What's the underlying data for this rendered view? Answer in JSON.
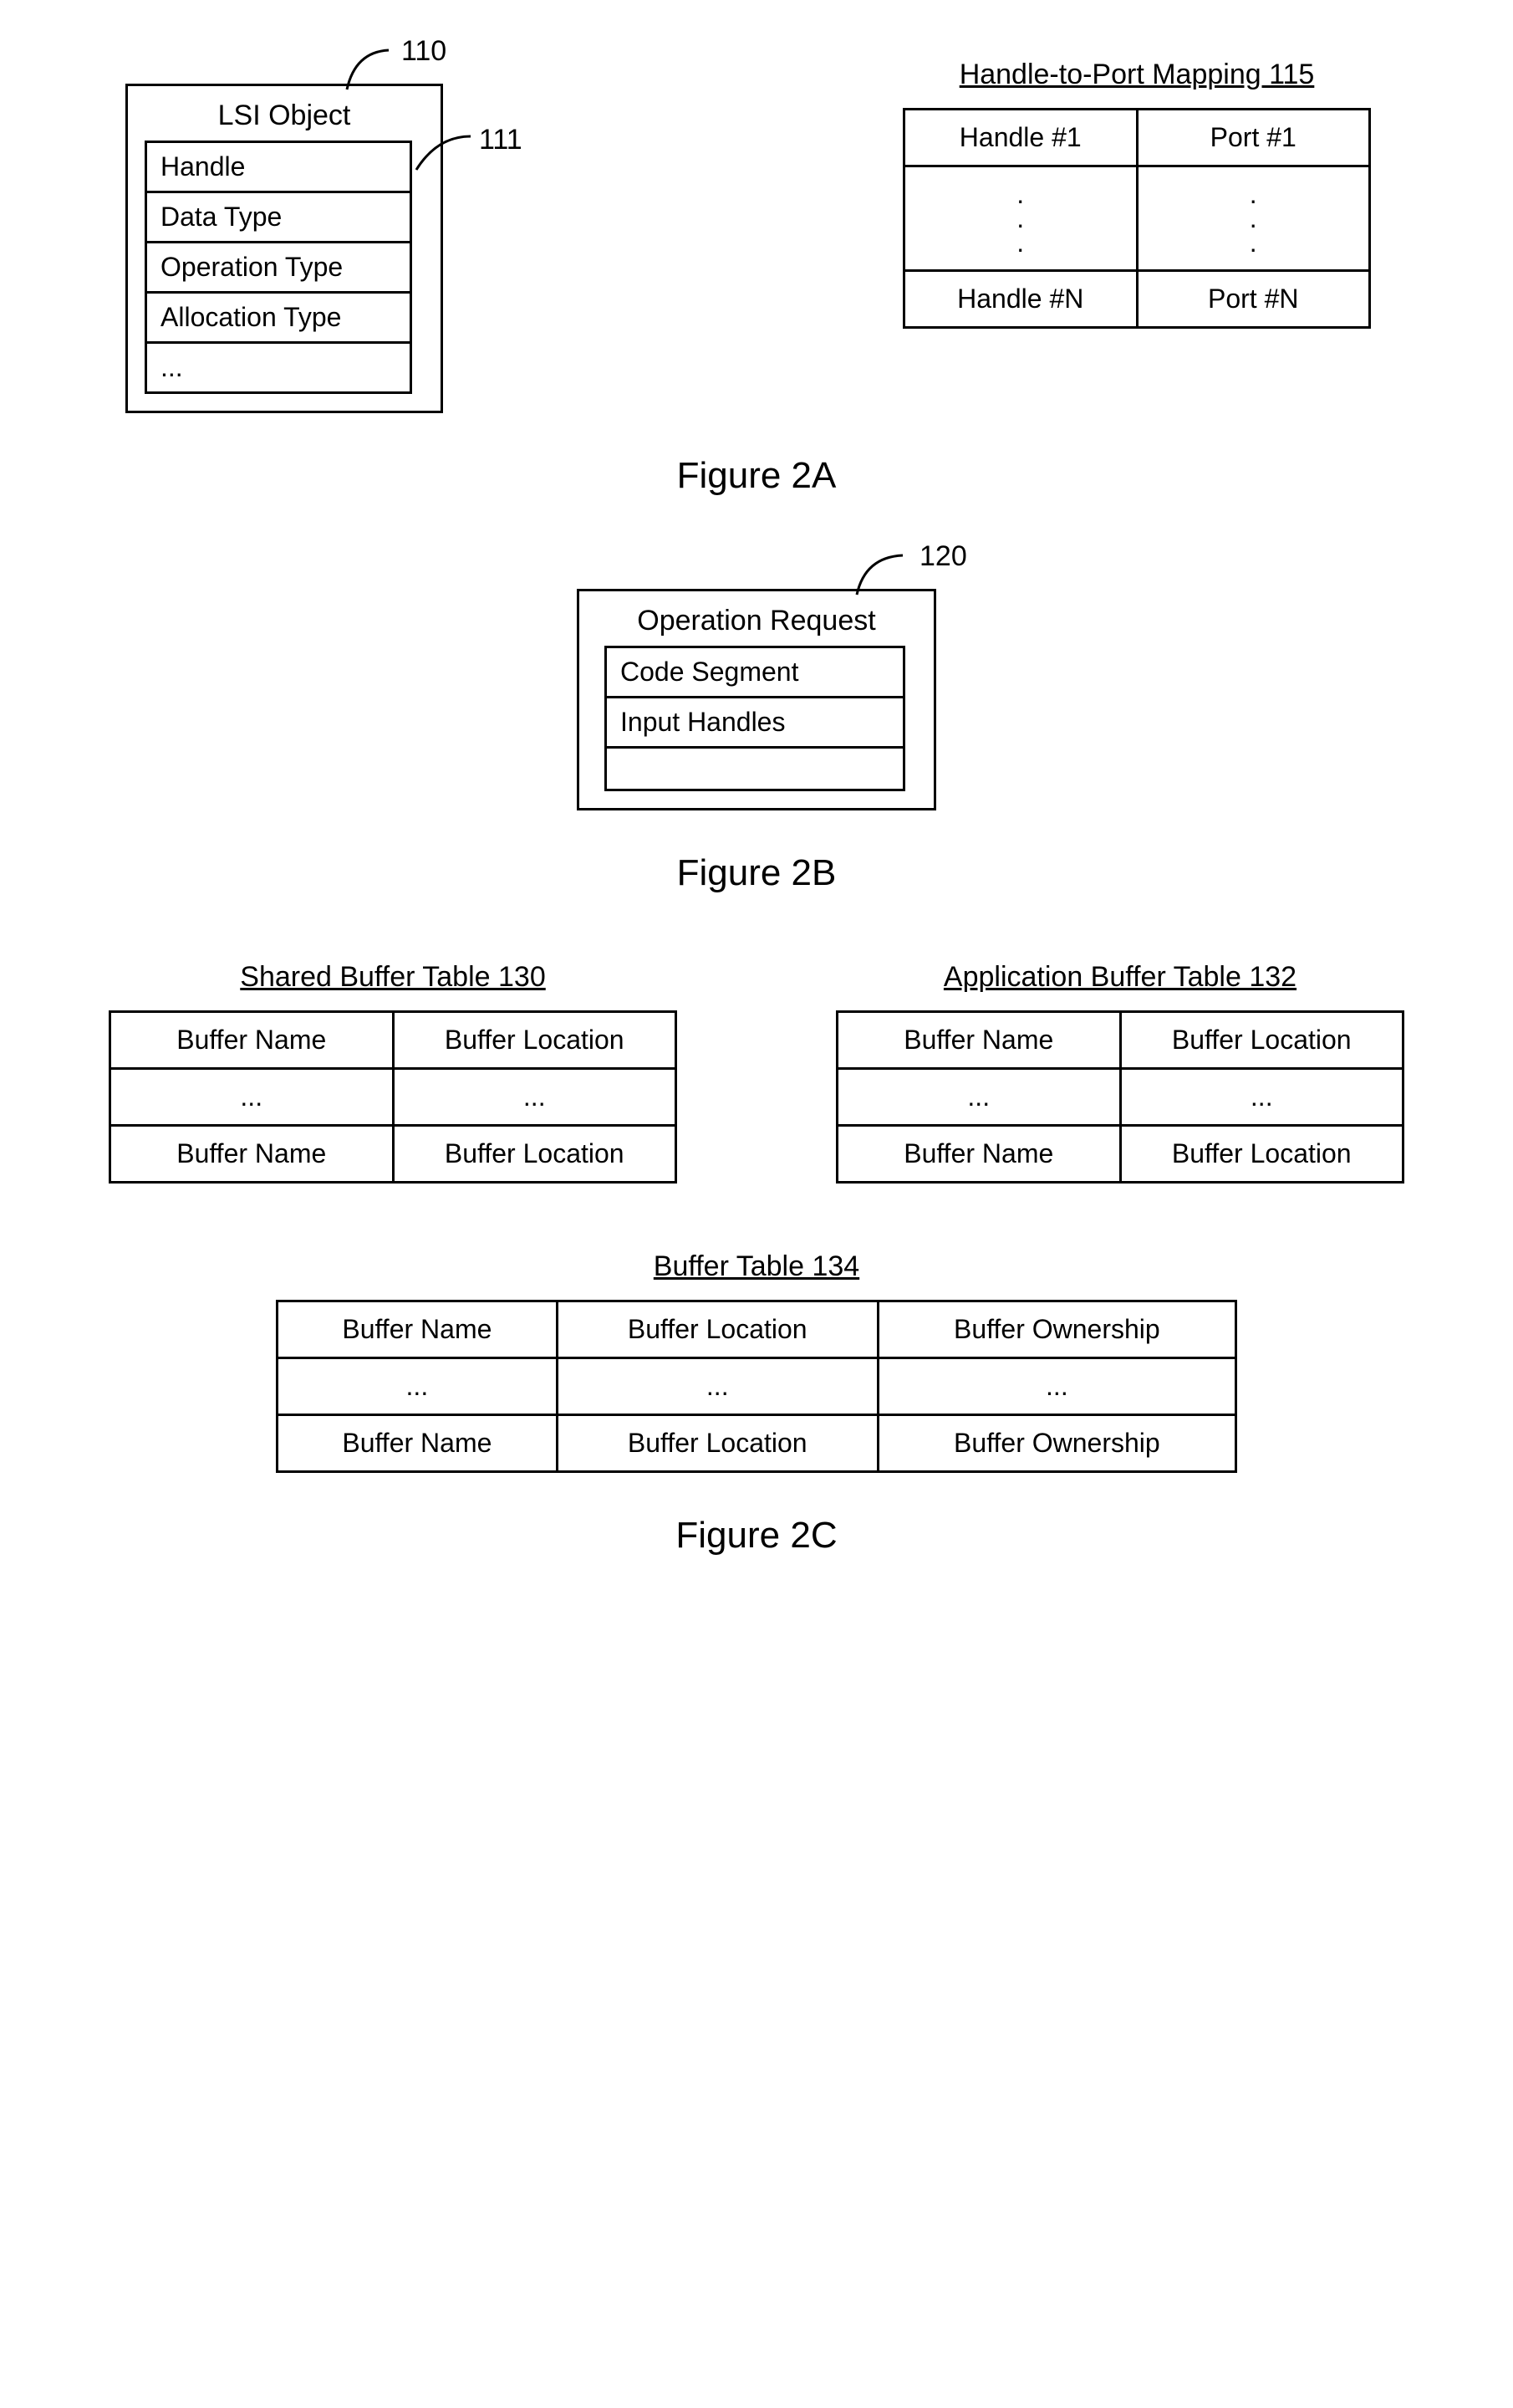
{
  "fig2a": {
    "lsi": {
      "callout_num": "110",
      "title": "LSI Object",
      "inner_callout_num": "111",
      "rows": [
        "Handle",
        "Data Type",
        "Operation Type",
        "Allocation Type",
        "..."
      ]
    },
    "mapping": {
      "title": "Handle-to-Port Mapping 115",
      "r1c1": "Handle #1",
      "r1c2": "Port #1",
      "r2c1": ".\n.\n.",
      "r2c2": ".\n.\n.",
      "r3c1": "Handle #N",
      "r3c2": "Port #N"
    },
    "caption": "Figure 2A"
  },
  "fig2b": {
    "op": {
      "callout_num": "120",
      "title": "Operation Request",
      "rows": [
        "Code Segment",
        "Input Handles",
        ""
      ]
    },
    "caption": "Figure 2B"
  },
  "fig2c": {
    "shared": {
      "title": "Shared Buffer Table 130",
      "r1c1": "Buffer Name",
      "r1c2": "Buffer Location",
      "r2c1": "...",
      "r2c2": "...",
      "r3c1": "Buffer Name",
      "r3c2": "Buffer Location"
    },
    "app": {
      "title": "Application Buffer Table 132",
      "r1c1": "Buffer Name",
      "r1c2": "Buffer Location",
      "r2c1": "...",
      "r2c2": "...",
      "r3c1": "Buffer Name",
      "r3c2": "Buffer Location"
    },
    "buf": {
      "title": "Buffer Table 134",
      "r1c1": "Buffer Name",
      "r1c2": "Buffer Location",
      "r1c3": "Buffer Ownership",
      "r2c1": "...",
      "r2c2": "...",
      "r2c3": "...",
      "r3c1": "Buffer Name",
      "r3c2": "Buffer Location",
      "r3c3": "Buffer Ownership"
    },
    "caption": "Figure 2C"
  }
}
